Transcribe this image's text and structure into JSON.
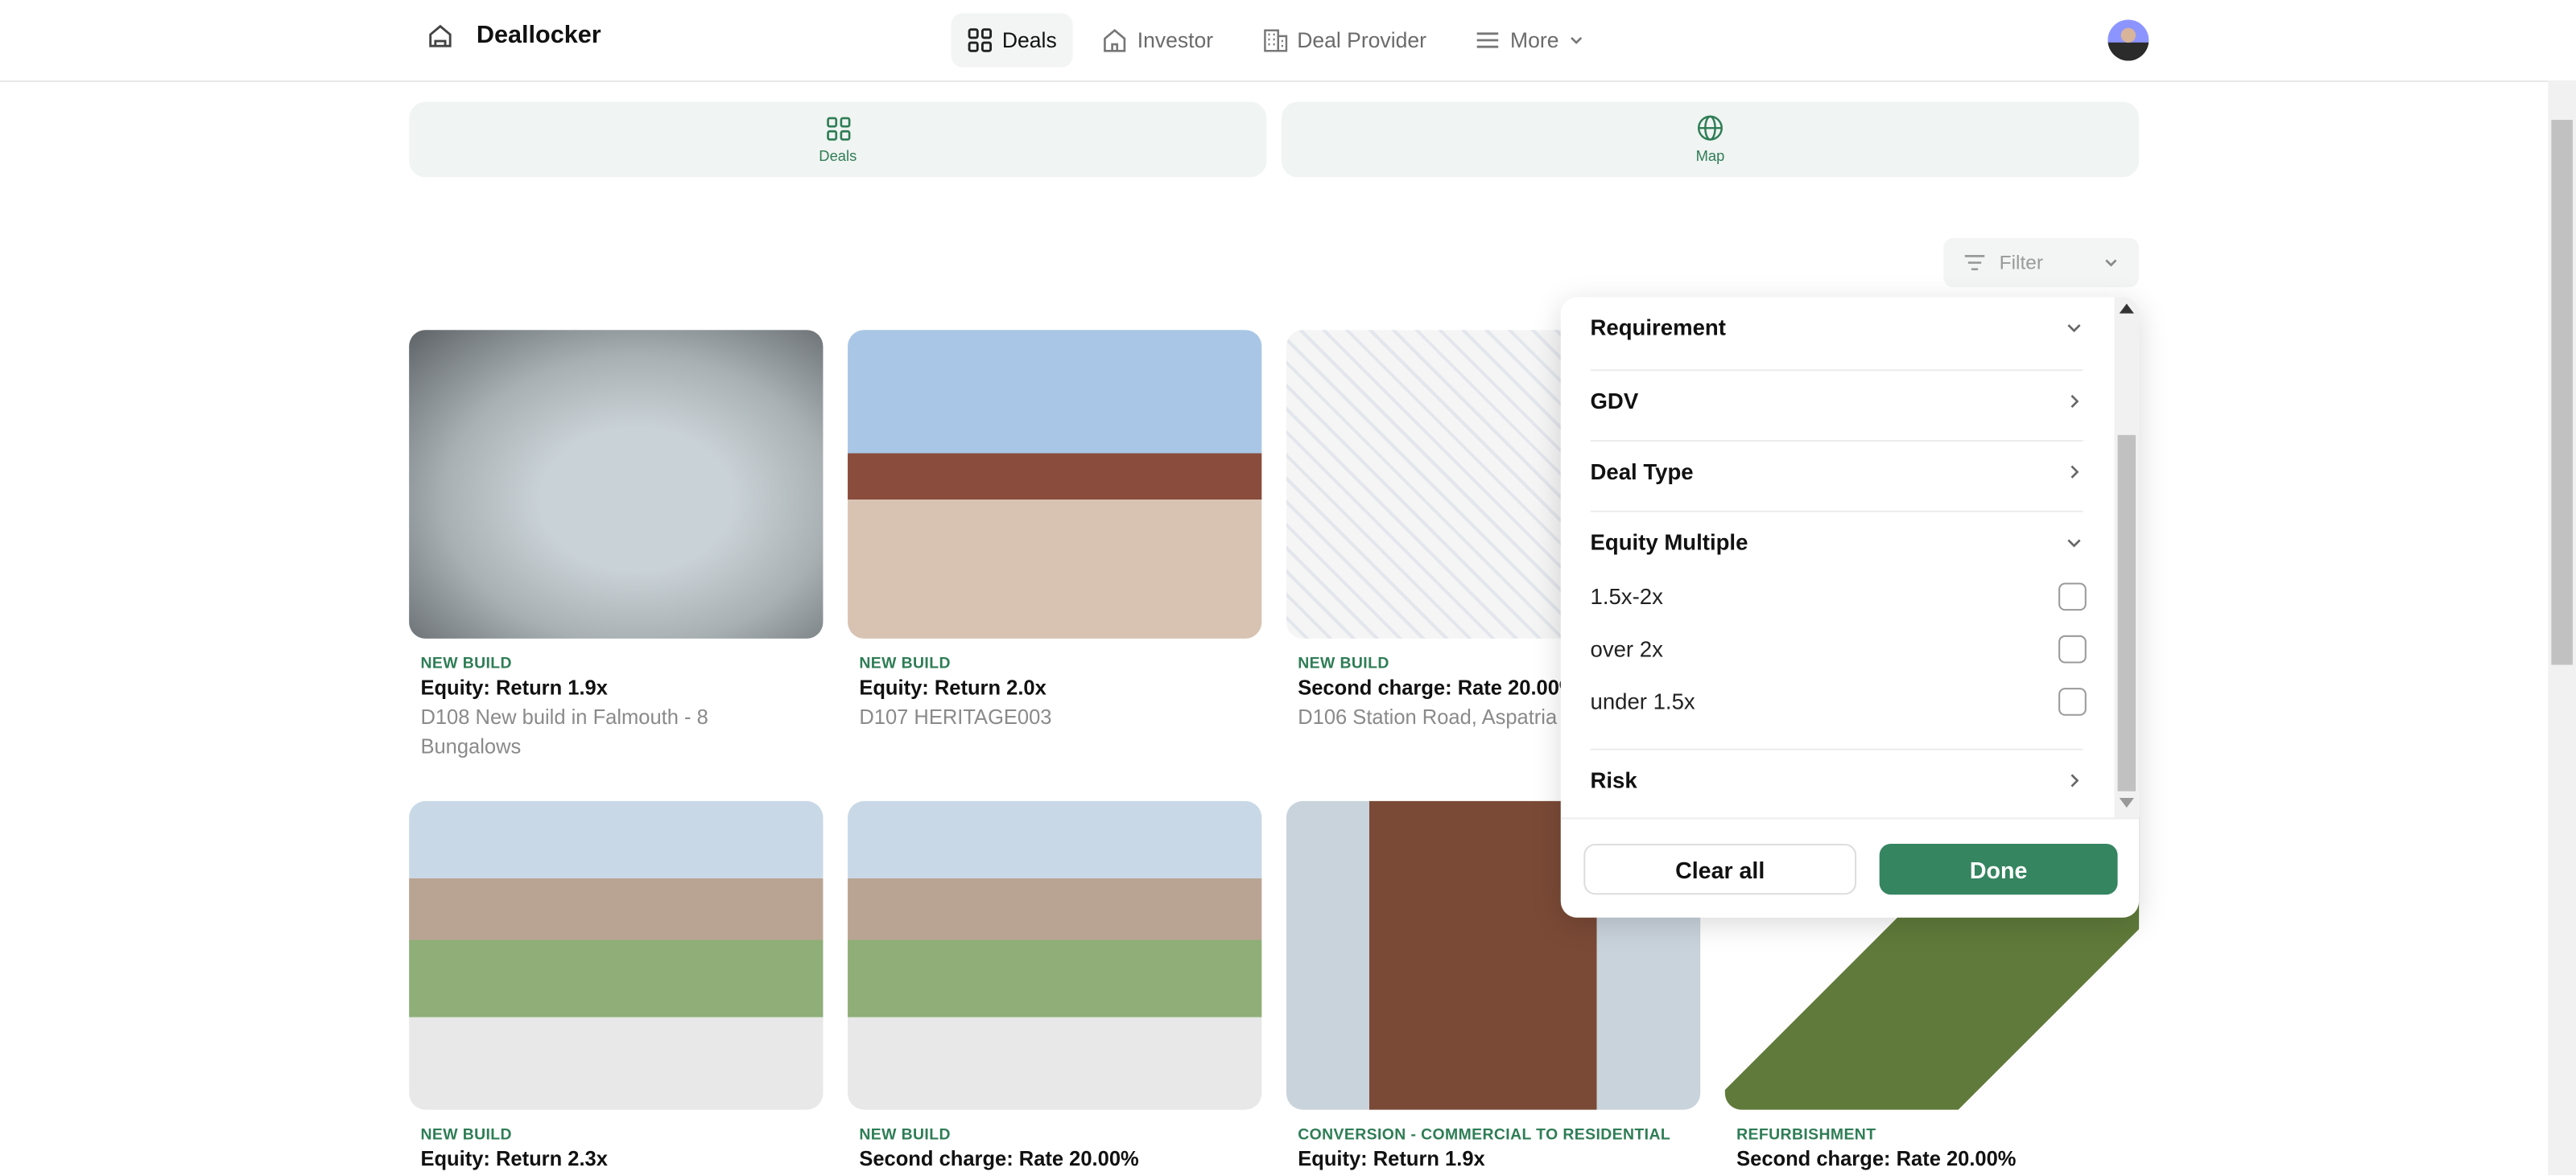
{
  "app": {
    "name": "Deallocker"
  },
  "nav": {
    "items": [
      {
        "label": "Deals",
        "icon": "grid-icon",
        "active": true
      },
      {
        "label": "Investor",
        "icon": "home-icon"
      },
      {
        "label": "Deal Provider",
        "icon": "building-icon"
      },
      {
        "label": "More",
        "icon": "menu-icon"
      }
    ]
  },
  "view_tabs": [
    {
      "label": "Deals",
      "icon": "grid-icon"
    },
    {
      "label": "Map",
      "icon": "globe-icon"
    }
  ],
  "filter": {
    "label": "Filter",
    "sections": [
      {
        "label": "Requirement",
        "state": "expanded"
      },
      {
        "label": "GDV",
        "state": "collapsed"
      },
      {
        "label": "Deal Type",
        "state": "collapsed"
      },
      {
        "label": "Equity Multiple",
        "state": "expanded"
      },
      {
        "label": "Risk",
        "state": "collapsed"
      }
    ],
    "equity_options": [
      {
        "label": "1.5x-2x",
        "checked": false
      },
      {
        "label": "over 2x",
        "checked": false
      },
      {
        "label": "under 1.5x",
        "checked": false
      }
    ],
    "clear_label": "Clear all",
    "done_label": "Done"
  },
  "colors": {
    "accent": "#2e7d55",
    "button": "#358560"
  },
  "deals": [
    {
      "category": "NEW BUILD",
      "title": "Equity: Return 1.9x",
      "name": "D108 New build in Falmouth - 8 Bungalows"
    },
    {
      "category": "NEW BUILD",
      "title": "Equity: Return 2.0x",
      "name": "D107 HERITAGE003"
    },
    {
      "category": "NEW BUILD",
      "title": "Second charge: Rate 20.00%",
      "name": "D106 Station Road, Aspatria"
    },
    {
      "category": "NEW BUILD",
      "title": "Equity: Return 2.3x",
      "name": ""
    },
    {
      "category": "NEW BUILD",
      "title": "Second charge: Rate 20.00%",
      "name": ""
    },
    {
      "category": "CONVERSION - COMMERCIAL TO RESIDENTIAL",
      "title": "Equity: Return 1.9x",
      "name": ""
    },
    {
      "category": "REFURBISHMENT",
      "title": "Second charge: Rate 20.00%",
      "name": ""
    }
  ]
}
